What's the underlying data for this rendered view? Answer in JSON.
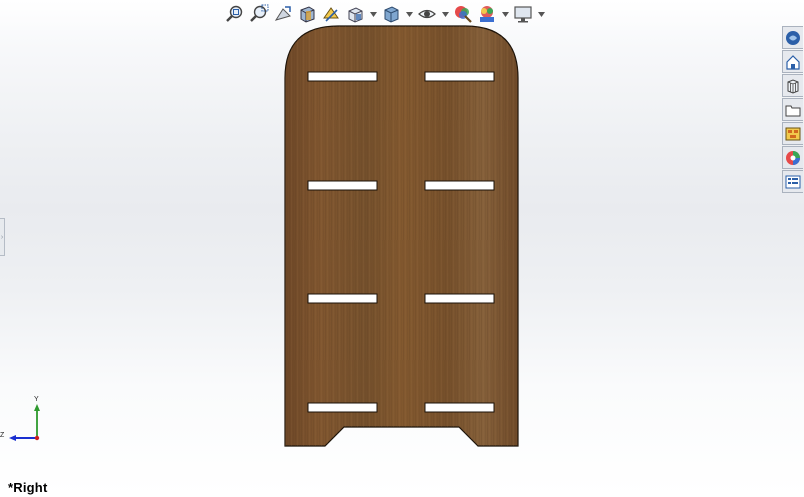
{
  "viewport": {
    "view_name": "*Right"
  },
  "triad": {
    "y_label": "Y",
    "z_label": "Z"
  },
  "hud_toolbar": {
    "items": [
      {
        "icon": "zoom-to-fit-icon"
      },
      {
        "icon": "zoom-to-area-icon"
      },
      {
        "icon": "previous-view-icon"
      },
      {
        "icon": "section-view-icon"
      },
      {
        "icon": "dynamic-annotation-views-icon"
      },
      {
        "icon": "view-orientation-icon"
      },
      {
        "icon": "display-style-icon"
      },
      {
        "icon": "hide-show-items-icon"
      },
      {
        "icon": "edit-appearance-icon"
      },
      {
        "icon": "apply-scene-icon"
      },
      {
        "icon": "view-settings-icon"
      }
    ]
  },
  "task_pane": {
    "tabs": [
      {
        "icon": "solidworks-resources-icon"
      },
      {
        "icon": "design-library-icon"
      },
      {
        "icon": "file-explorer-icon"
      },
      {
        "icon": "view-palette-icon"
      },
      {
        "icon": "appearances-scenes-icon"
      },
      {
        "icon": "custom-properties-icon"
      },
      {
        "icon": "solidworks-forum-icon"
      }
    ]
  },
  "colors": {
    "wood_base": "#7a5230",
    "wood_dark": "#5e3d20",
    "wood_light": "#8d6238",
    "slot": "#ffffff",
    "accent_blue": "#2b5fa8",
    "axis_green": "#2e9a2e",
    "axis_blue": "#1a2fd0",
    "axis_red": "#cc1f1f"
  }
}
